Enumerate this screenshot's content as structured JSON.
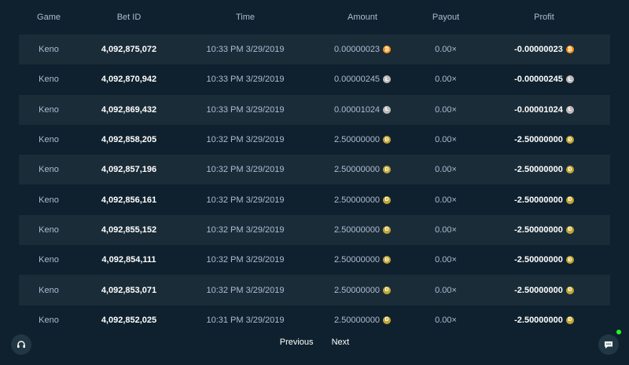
{
  "columns": {
    "game": "Game",
    "bet_id": "Bet ID",
    "time": "Time",
    "amount": "Amount",
    "payout": "Payout",
    "profit": "Profit"
  },
  "rows": [
    {
      "game": "Keno",
      "bet_id": "4,092,875,072",
      "time": "10:33 PM 3/29/2019",
      "amount": "0.00000023",
      "payout": "0.00×",
      "profit": "-0.00000023",
      "coin": "btc-icon"
    },
    {
      "game": "Keno",
      "bet_id": "4,092,870,942",
      "time": "10:33 PM 3/29/2019",
      "amount": "0.00000245",
      "payout": "0.00×",
      "profit": "-0.00000245",
      "coin": "ltc-icon"
    },
    {
      "game": "Keno",
      "bet_id": "4,092,869,432",
      "time": "10:33 PM 3/29/2019",
      "amount": "0.00001024",
      "payout": "0.00×",
      "profit": "-0.00001024",
      "coin": "ltc-icon"
    },
    {
      "game": "Keno",
      "bet_id": "4,092,858,205",
      "time": "10:32 PM 3/29/2019",
      "amount": "2.50000000",
      "payout": "0.00×",
      "profit": "-2.50000000",
      "coin": "doge-icon"
    },
    {
      "game": "Keno",
      "bet_id": "4,092,857,196",
      "time": "10:32 PM 3/29/2019",
      "amount": "2.50000000",
      "payout": "0.00×",
      "profit": "-2.50000000",
      "coin": "doge-icon"
    },
    {
      "game": "Keno",
      "bet_id": "4,092,856,161",
      "time": "10:32 PM 3/29/2019",
      "amount": "2.50000000",
      "payout": "0.00×",
      "profit": "-2.50000000",
      "coin": "doge-icon"
    },
    {
      "game": "Keno",
      "bet_id": "4,092,855,152",
      "time": "10:32 PM 3/29/2019",
      "amount": "2.50000000",
      "payout": "0.00×",
      "profit": "-2.50000000",
      "coin": "doge-icon"
    },
    {
      "game": "Keno",
      "bet_id": "4,092,854,111",
      "time": "10:32 PM 3/29/2019",
      "amount": "2.50000000",
      "payout": "0.00×",
      "profit": "-2.50000000",
      "coin": "doge-icon"
    },
    {
      "game": "Keno",
      "bet_id": "4,092,853,071",
      "time": "10:32 PM 3/29/2019",
      "amount": "2.50000000",
      "payout": "0.00×",
      "profit": "-2.50000000",
      "coin": "doge-icon"
    },
    {
      "game": "Keno",
      "bet_id": "4,092,852,025",
      "time": "10:31 PM 3/29/2019",
      "amount": "2.50000000",
      "payout": "0.00×",
      "profit": "-2.50000000",
      "coin": "doge-icon"
    }
  ],
  "coins": {
    "btc-icon": {
      "color": "#f7931a",
      "glyph": "₿"
    },
    "ltc-icon": {
      "color": "#bfbbbb",
      "glyph": "Ł"
    },
    "doge-icon": {
      "color": "#c2a633",
      "glyph": "Ð"
    }
  },
  "pagination": {
    "previous": "Previous",
    "next": "Next"
  },
  "widgets": {
    "support_icon": "headset-icon",
    "chat_icon": "chat-icon",
    "online_color": "#1fff20"
  }
}
